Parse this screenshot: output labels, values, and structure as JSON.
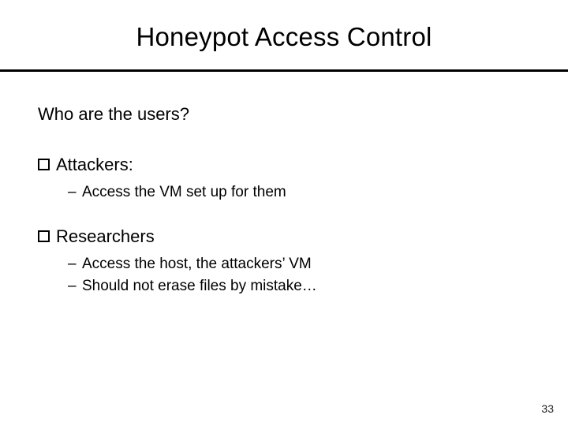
{
  "title": "Honeypot Access Control",
  "lead": "Who are the users?",
  "items": [
    {
      "label": "Attackers:",
      "subs": [
        "Access the VM set up for them"
      ]
    },
    {
      "label": "Researchers",
      "subs": [
        "Access the host, the attackers’ VM",
        "Should not erase files by mistake…"
      ]
    }
  ],
  "page_number": "33"
}
